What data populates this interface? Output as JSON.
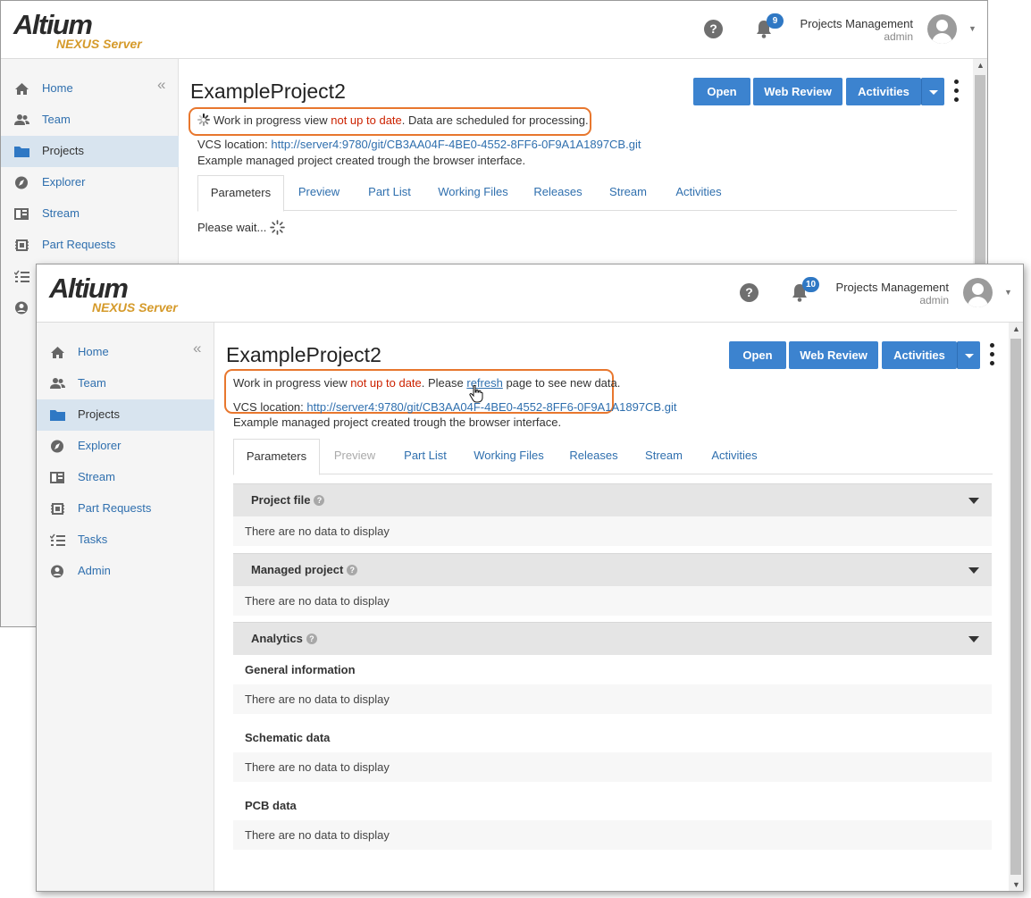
{
  "header": {
    "logo_main": "Altium",
    "logo_sub": "NEXUS Server",
    "help_glyph": "?",
    "user_name": "Projects Management",
    "user_role": "admin"
  },
  "window_back": {
    "notifications_count": "9"
  },
  "window_front": {
    "notifications_count": "10"
  },
  "sidebar": {
    "items": [
      {
        "label": "Home",
        "icon": "home-icon"
      },
      {
        "label": "Team",
        "icon": "team-icon"
      },
      {
        "label": "Projects",
        "icon": "folder-icon"
      },
      {
        "label": "Explorer",
        "icon": "compass-icon"
      },
      {
        "label": "Stream",
        "icon": "stream-icon"
      },
      {
        "label": "Part Requests",
        "icon": "chip-icon"
      },
      {
        "label": "Tasks",
        "icon": "tasks-icon"
      },
      {
        "label": "Admin",
        "icon": "admin-icon"
      }
    ],
    "active": "Projects"
  },
  "project": {
    "title": "ExampleProject2",
    "vcs_label": "VCS location:",
    "vcs_url": "http://server4:9780/git/CB3AA04F-4BE0-4552-8FF6-0F9A1A1897CB.git",
    "description": "Example managed project created trough the browser interface."
  },
  "toolbar": {
    "open": "Open",
    "web_review": "Web Review",
    "activities": "Activities"
  },
  "status_back": {
    "prefix": "Work in progress view ",
    "highlight": "not up to date",
    "suffix": ". Data are scheduled for processing."
  },
  "status_front": {
    "prefix": "Work in progress view ",
    "highlight": "not up to date",
    "middle": ". Please ",
    "link": "refresh",
    "suffix": " page to see new data."
  },
  "tabs": [
    "Parameters",
    "Preview",
    "Part List",
    "Working Files",
    "Releases",
    "Stream",
    "Activities"
  ],
  "please_wait": "Please wait...",
  "sections": {
    "project_file": "Project file",
    "managed_project": "Managed project",
    "analytics": "Analytics",
    "general_information": "General information",
    "schematic_data": "Schematic data",
    "pcb_data": "PCB data",
    "no_data": "There are no data to display"
  },
  "colors": {
    "accent_blue": "#3c83cf",
    "link_blue": "#2f6fae",
    "warning_red": "#cc2200",
    "highlight_orange": "#e8772e",
    "brand_gold": "#d59a2a",
    "active_nav": "#d8e4ef"
  }
}
